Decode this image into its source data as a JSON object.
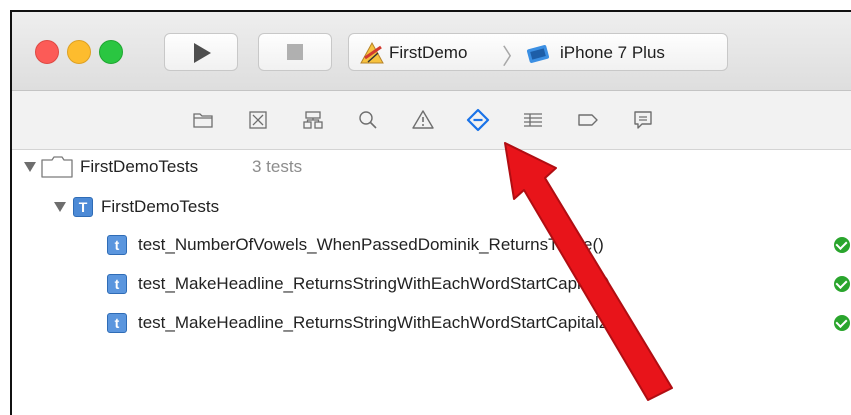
{
  "toolbar": {
    "scheme_name": "FirstDemo",
    "scheme_separator": "〉",
    "device_name": "iPhone 7 Plus"
  },
  "navigator": {
    "tabs": [
      "project",
      "source-control",
      "symbol",
      "find",
      "issue",
      "test",
      "debug",
      "breakpoint",
      "report"
    ],
    "selected_tab": "test",
    "accent_color": "#1a73e8"
  },
  "tree": {
    "root": {
      "label": "FirstDemoTests",
      "count": "3 tests"
    },
    "target": {
      "label": "FirstDemoTests",
      "badge": "T"
    },
    "tests": [
      {
        "badge": "t",
        "label": "test_NumberOfVowels_WhenPassedDominik_ReturnsThree()",
        "status": "passed"
      },
      {
        "badge": "t",
        "label": "test_MakeHeadline_ReturnsStringWithEachWordStartCapital()",
        "status": "passed"
      },
      {
        "badge": "t",
        "label": "test_MakeHeadline_ReturnsStringWithEachWordStartCapital2()",
        "status": "passed"
      }
    ]
  },
  "annotation": {
    "color": "#e8141a"
  }
}
